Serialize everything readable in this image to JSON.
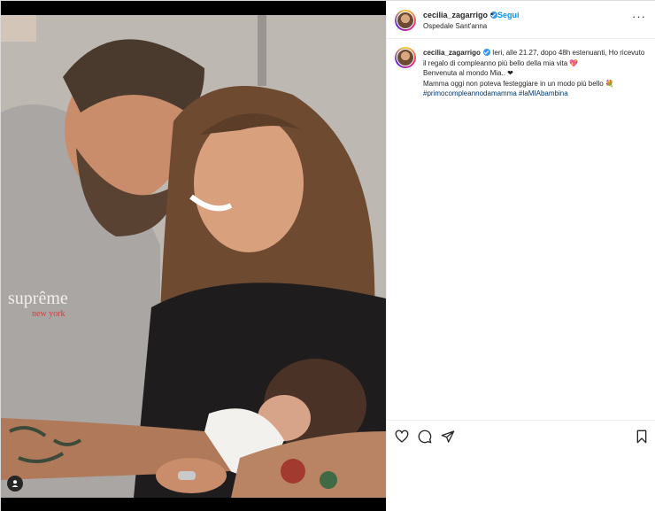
{
  "post": {
    "username": "cecilia_zagarrigo",
    "follow_label": "Segui",
    "separator": "•",
    "location": "Ospedale Sant'anna",
    "more_label": "···"
  },
  "caption": {
    "username": "cecilia_zagarrigo",
    "line1": "Ieri, alle 21.27, dopo 48h estenuanti, Ho ricevuto il regalo di compleanno più bello della mia vita 💖",
    "line2": "Benvenuta al mondo Mia.. ❤",
    "line3": "Mamma oggi non poteva festeggiare in un modo più bello 💐",
    "hashtags": "#primocompleannodamamma #laMIAbambina"
  },
  "photo": {
    "shirt_text_line1": "suprême",
    "shirt_text_line2": "new york"
  },
  "icons": {
    "like": "heart-icon",
    "comment": "comment-icon",
    "share": "share-icon",
    "save": "bookmark-icon",
    "tag": "user-tag-icon"
  },
  "colors": {
    "link_blue": "#0095f6",
    "hashtag_blue": "#00376b",
    "verified_blue": "#3897f0"
  }
}
